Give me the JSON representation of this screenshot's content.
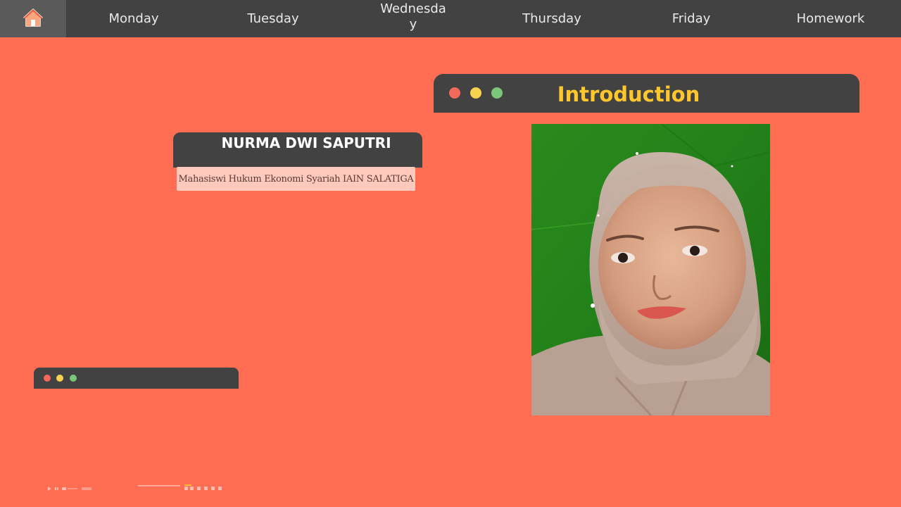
{
  "nav": {
    "home_icon": "home-icon",
    "items": [
      {
        "label": "Monday"
      },
      {
        "label": "Tuesday"
      },
      {
        "label": "Wednesday"
      },
      {
        "label": "Thursday"
      },
      {
        "label": "Friday"
      },
      {
        "label": "Homework"
      }
    ]
  },
  "profile": {
    "name": "NURMA DWI SAPUTRI",
    "subtitle": "Mahasiswi Hukum Ekonomi Syariah IAIN SALATIGA"
  },
  "intro": {
    "title": "Introduction"
  },
  "photo": {
    "subject": "portrait-photo"
  },
  "colors": {
    "background": "#FF6D52",
    "bar": "#424242",
    "dot_red": "#F26A5A",
    "dot_yellow": "#F5D350",
    "dot_green": "#7BC67A",
    "title_yellow": "#FFC72C"
  }
}
